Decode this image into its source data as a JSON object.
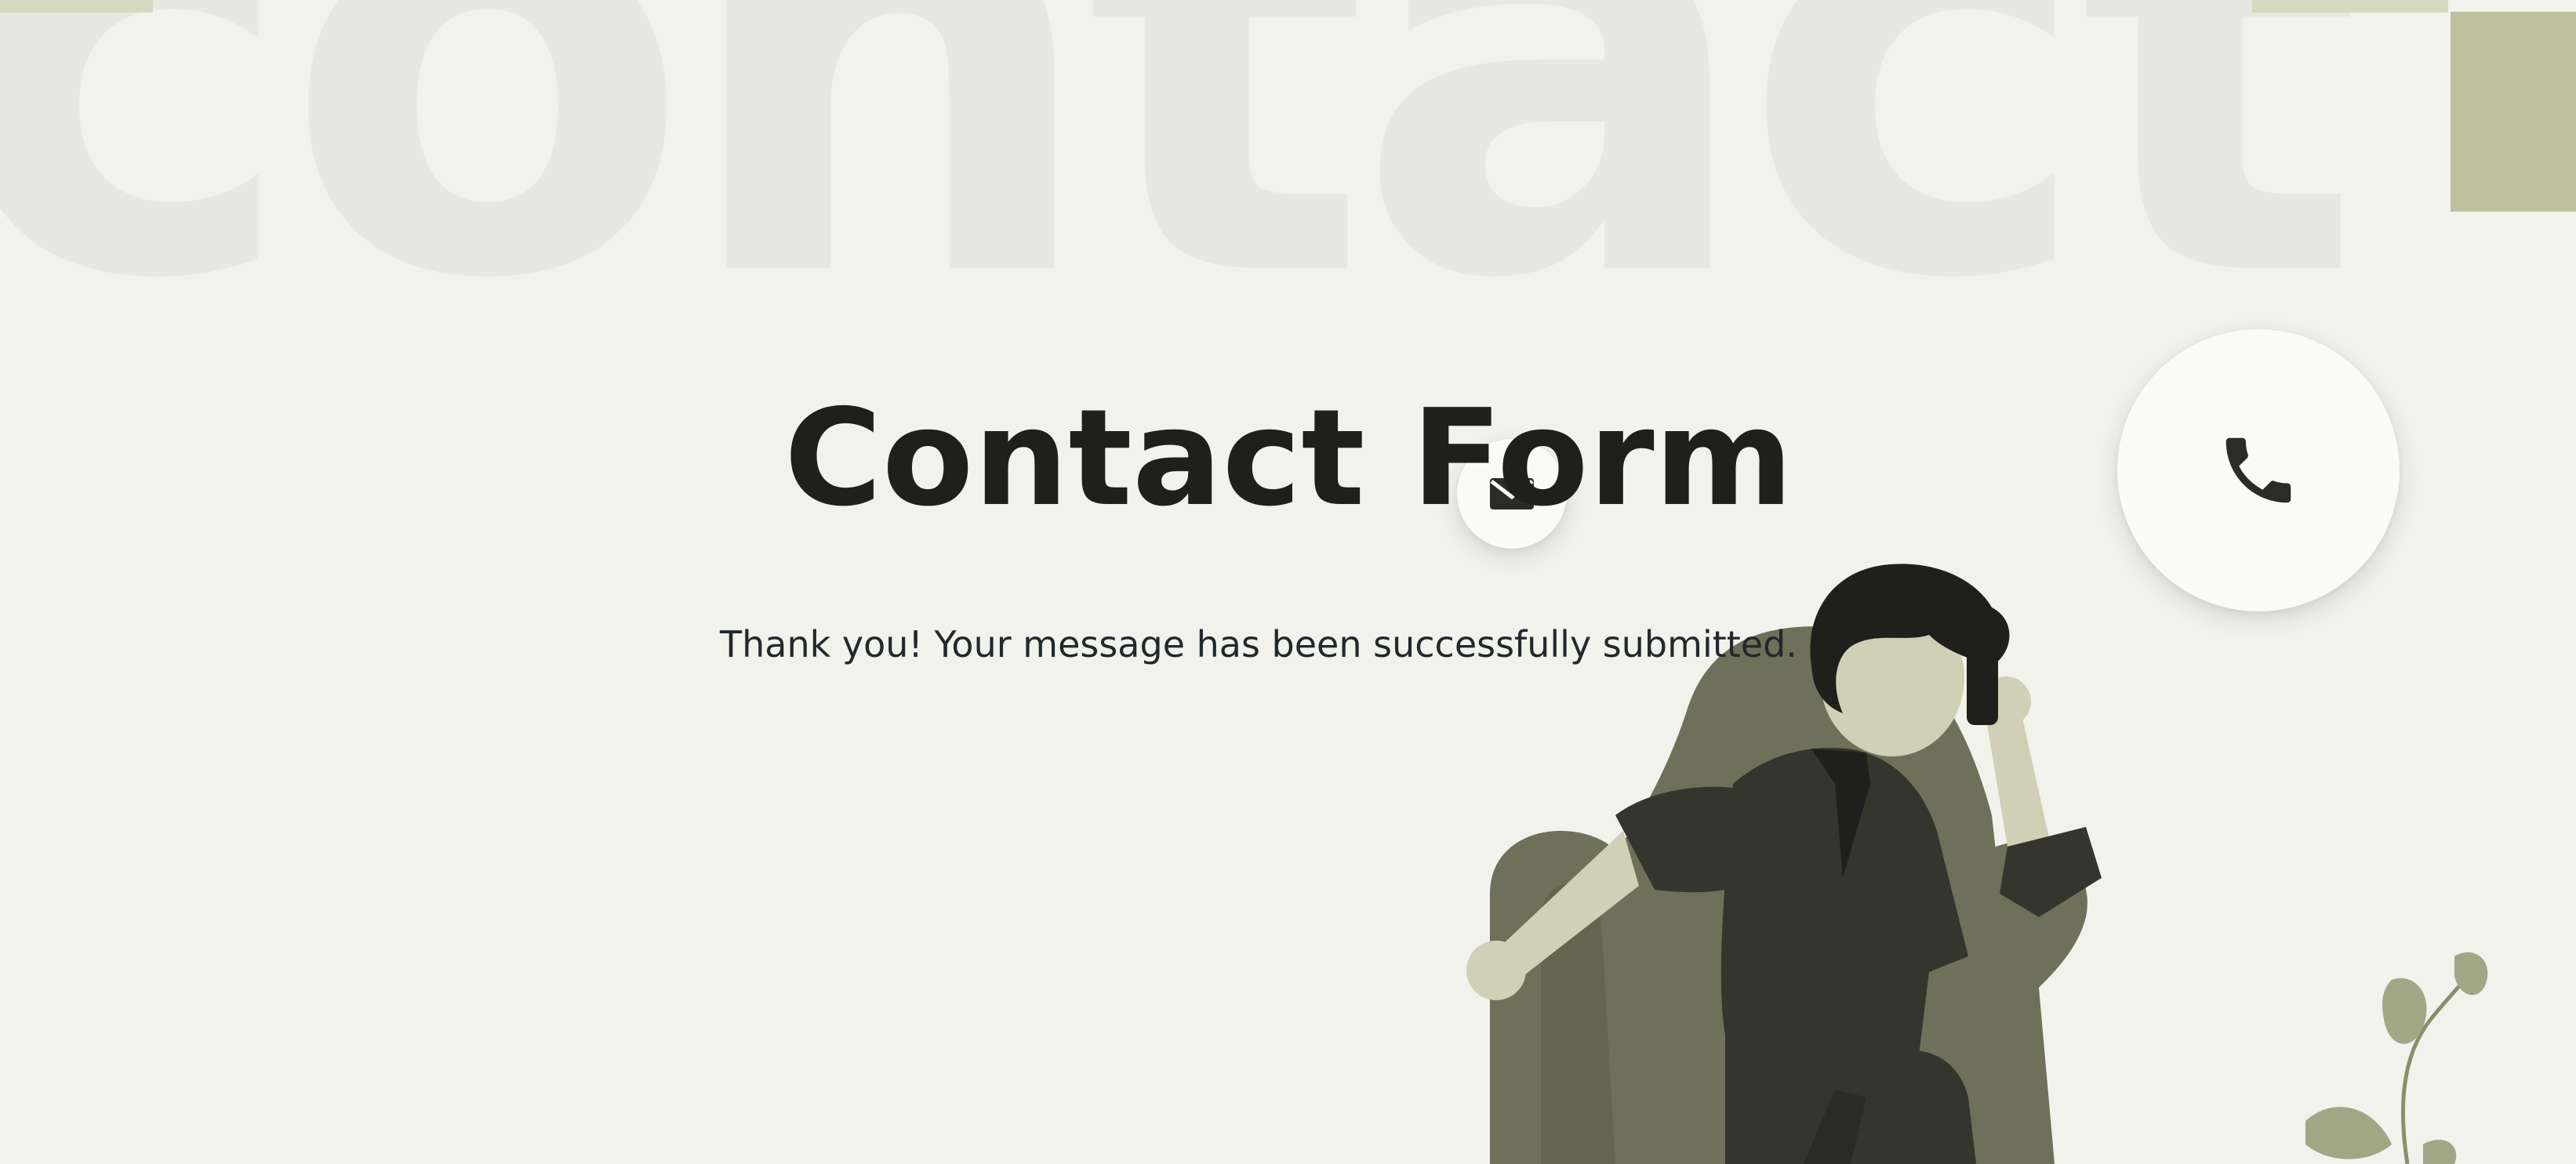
{
  "background_word": "contact",
  "title": "Contact Form",
  "message": "Thank you! Your message has been successfully submitted.",
  "icons": {
    "phone": "phone-icon",
    "mail": "mail-icon"
  },
  "colors": {
    "background": "#f1f2ec",
    "watermark": "#e7e9e0",
    "accent_block": "#bfc19e",
    "title_text": "#1f201c",
    "message_text": "#22282b",
    "armchair": "#6e705a",
    "clothing": "#34352d",
    "skin": "#cfd0b6",
    "plant": "#a1a685"
  }
}
